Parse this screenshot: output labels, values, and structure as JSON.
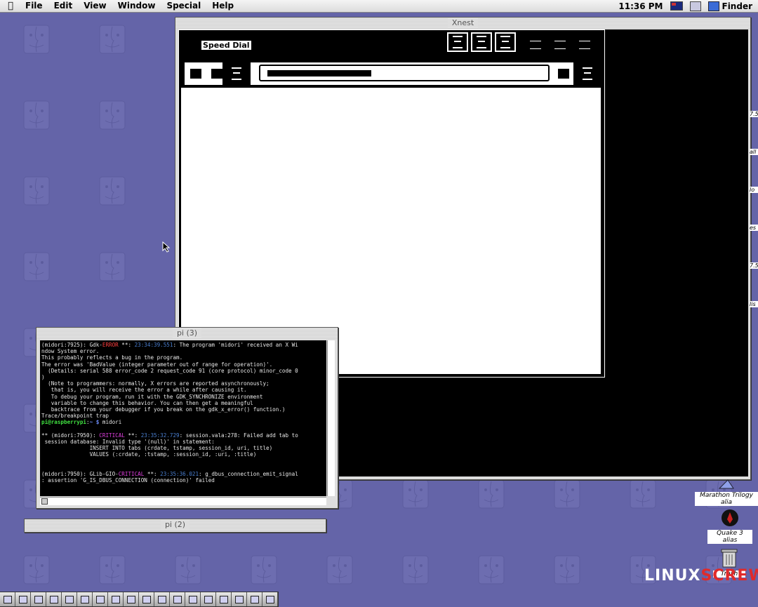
{
  "menubar": {
    "items": [
      "File",
      "Edit",
      "View",
      "Window",
      "Special",
      "Help"
    ],
    "clock": "11:36 PM",
    "active_app": "Finder"
  },
  "xnest": {
    "title": "Xnest",
    "midori_tab_title": "Speed Dial"
  },
  "terminal_pi3": {
    "title": "pi (3)"
  },
  "terminal_pi2": {
    "title": "pi (2)"
  },
  "desktop_icons": [
    {
      "label": "Marathon Trilogy alia"
    },
    {
      "label": "Quake 3 alias"
    },
    {
      "label": "Trash"
    }
  ],
  "side_labels": [
    "7.5",
    "all",
    "lo",
    "es",
    "7.5",
    "lis"
  ],
  "watermark": {
    "part1": "LINUX",
    "part2": "SCREW"
  },
  "colors": {
    "desktop": "#6464a8",
    "accent_error": "#ff4040",
    "prompt_user": "#40e040"
  }
}
